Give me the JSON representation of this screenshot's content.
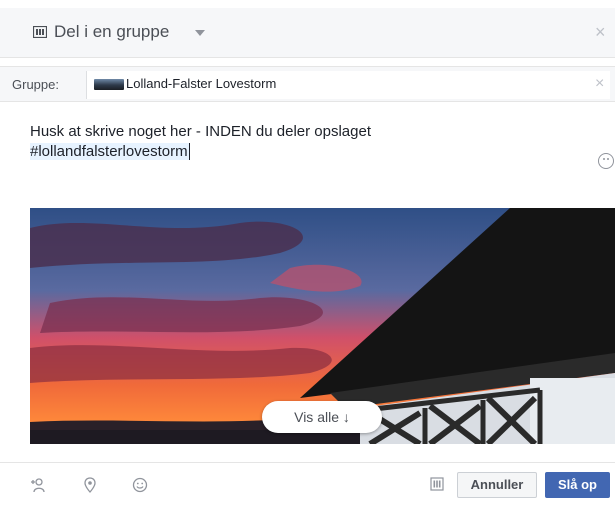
{
  "header": {
    "title": "Del i en gruppe",
    "close_glyph": "×",
    "icon": "share-group-icon"
  },
  "group": {
    "label": "Gruppe:",
    "name": "Lolland-Falster Lovestorm",
    "remove_glyph": "×"
  },
  "composer": {
    "line1": "Husk at skrive noget her - INDEN du deler opslaget",
    "hashtag": "#lollandfalsterlovestorm"
  },
  "preview": {
    "show_all_label": "Vis alle ↓"
  },
  "footer": {
    "tag_icon": "tag-people-icon",
    "location_icon": "location-pin-icon",
    "feeling_icon": "smiley-icon",
    "audience_icon": "audience-icon",
    "cancel_label": "Annuller",
    "post_label": "Slå op"
  },
  "colors": {
    "primary": "#4267b2",
    "header_bg": "#f6f7f9",
    "hashtag_bg": "#e7f3ff"
  }
}
